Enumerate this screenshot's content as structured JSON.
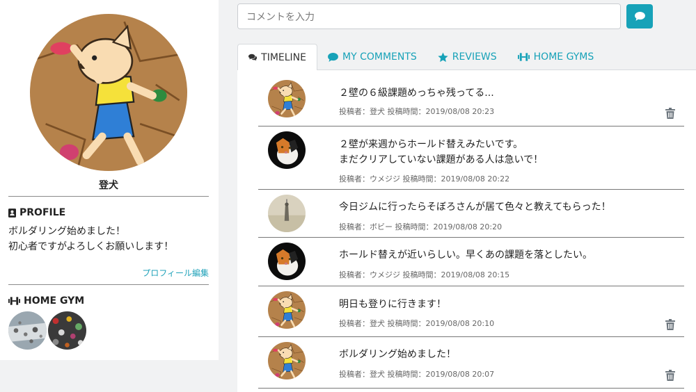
{
  "profile": {
    "name": "登犬",
    "profile_heading": "PROFILE",
    "bio": "ボルダリング始めました！\n初心者ですがよろしくお願いします！",
    "edit_link": "プロフィール編集",
    "home_gym_heading": "HOME GYM",
    "gyms": [
      "gym-photo-1",
      "gym-photo-2"
    ]
  },
  "composer": {
    "placeholder": "コメントを入力",
    "send_icon": "comment-icon"
  },
  "tabs": [
    {
      "label": "TIMELINE",
      "icon": "comments-icon",
      "active": true
    },
    {
      "label": "MY COMMENTS",
      "icon": "comment-icon",
      "active": false
    },
    {
      "label": "REVIEWS",
      "icon": "star-icon",
      "active": false
    },
    {
      "label": "HOME GYMS",
      "icon": "dumbbell-icon",
      "active": false
    }
  ],
  "posts": [
    {
      "text": "２壁の６級課題めっちゃ残ってる...",
      "meta": "投稿者：登犬 投稿時間：2019/08/08 20:23",
      "avatar": "dog",
      "deletable": true
    },
    {
      "text": "２壁が来週からホールド替えみたいです。\nまだクリアしていない課題がある人は急いで！",
      "meta": "投稿者：ウメジジ 投稿時間：2019/08/08 20:22",
      "avatar": "cat",
      "deletable": false
    },
    {
      "text": "今日ジムに行ったらそぼろさんが居て色々と教えてもらった！",
      "meta": "投稿者：ボビー 投稿時間：2019/08/08 20:20",
      "avatar": "tower",
      "deletable": false
    },
    {
      "text": "ホールド替えが近いらしい。早くあの課題を落としたい。",
      "meta": "投稿者：ウメジジ 投稿時間：2019/08/08 20:15",
      "avatar": "cat",
      "deletable": false
    },
    {
      "text": "明日も登りに行きます！",
      "meta": "投稿者：登犬 投稿時間：2019/08/08 20:10",
      "avatar": "dog",
      "deletable": true
    },
    {
      "text": "ボルダリング始めました！",
      "meta": "投稿者：登犬 投稿時間：2019/08/08 20:07",
      "avatar": "dog",
      "deletable": true
    }
  ],
  "colors": {
    "accent": "#17a2b8",
    "wall": "#b5824b"
  }
}
